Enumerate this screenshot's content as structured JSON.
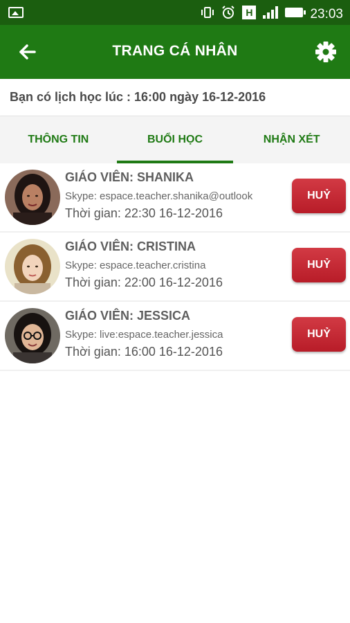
{
  "statusbar": {
    "time": "23:03",
    "h_label": "H"
  },
  "header": {
    "title": "TRANG CÁ NHÂN"
  },
  "notice": {
    "text": "Bạn có lịch học lúc : 16:00 ngày 16-12-2016"
  },
  "tabs": [
    {
      "label": "THÔNG TIN"
    },
    {
      "label": "BUỔI HỌC"
    },
    {
      "label": "NHẬN XÉT"
    }
  ],
  "sessions": [
    {
      "teacher": "GIÁO VIÊN: SHANIKA",
      "skype": "Skype: espace.teacher.shanika@outlook",
      "time": "Thời gian: 22:30 16-12-2016",
      "cancel_label": "HUỶ"
    },
    {
      "teacher": "GIÁO VIÊN: CRISTINA",
      "skype": "Skype: espace.teacher.cristina",
      "time": "Thời gian: 22:00 16-12-2016",
      "cancel_label": "HUỶ"
    },
    {
      "teacher": "GIÁO VIÊN: JESSICA",
      "skype": "Skype: live:espace.teacher.jessica",
      "time": "Thời gian: 16:00 16-12-2016",
      "cancel_label": "HUỶ"
    }
  ],
  "colors": {
    "primary": "#1f7a14",
    "statusbar": "#1b5e0f",
    "cancel": "#c4262f"
  }
}
